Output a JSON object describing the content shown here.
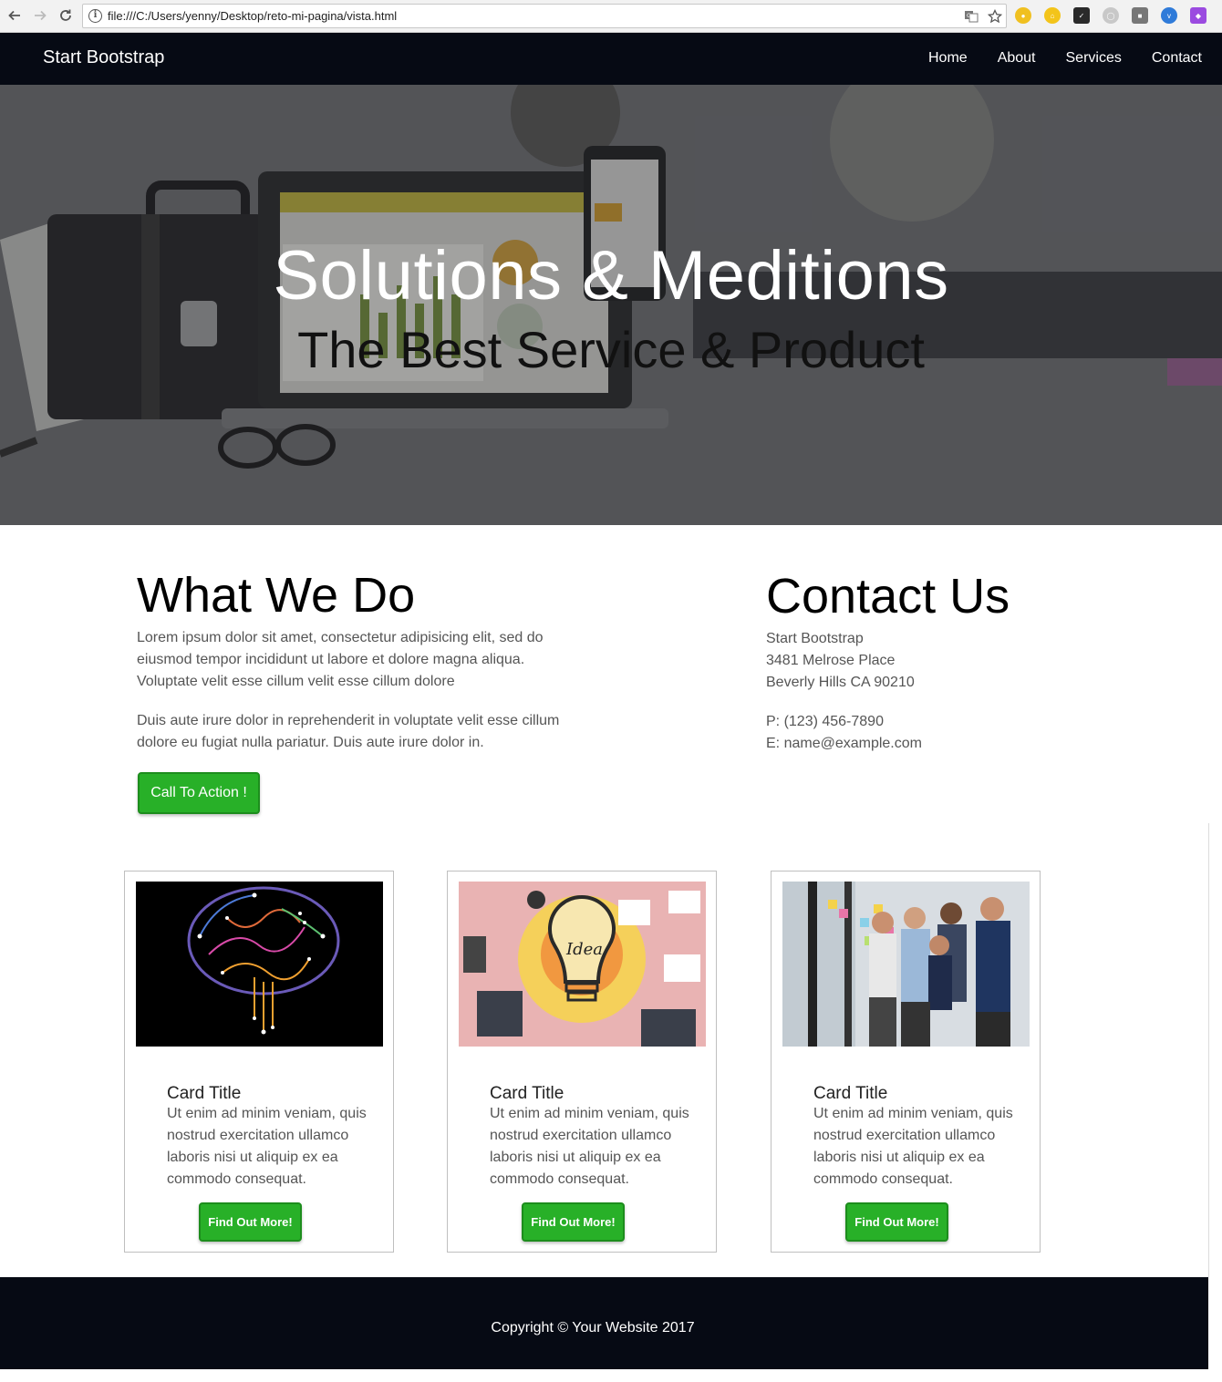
{
  "browser": {
    "url": "file:///C:/Users/yenny/Desktop/reto-mi-pagina/vista.html"
  },
  "navbar": {
    "brand": "Start Bootstrap",
    "links": [
      "Home",
      "About",
      "Services",
      "Contact"
    ]
  },
  "hero": {
    "title": "Solutions & Meditions",
    "subtitle": "The Best Service & Product"
  },
  "what_we_do": {
    "heading": "What We Do",
    "para1_lines": [
      "Lorem ipsum dolor sit amet, consectetur adipisicing elit, sed do",
      "eiusmod tempor incididunt ut labore et dolore magna aliqua.",
      "Voluptate velit esse cillum velit esse cillum dolore"
    ],
    "para2_lines": [
      "Duis aute irure dolor in reprehenderit in voluptate velit esse cillum",
      "dolore eu fugiat nulla pariatur. Duis aute irure dolor in."
    ],
    "cta_label": "Call To Action !"
  },
  "contact": {
    "heading": "Contact Us",
    "address_lines": [
      "Start Bootstrap",
      "3481 Melrose Place",
      "Beverly Hills CA 90210"
    ],
    "phone": "P: (123) 456-7890",
    "email": "E: name@example.com"
  },
  "cards": [
    {
      "title": "Card Title",
      "text_lines": [
        "Ut enim ad minim veniam, quis",
        "nostrud exercitation ullamco",
        "laboris nisi ut aliquip ex ea",
        "commodo consequat."
      ],
      "button": "Find Out More!"
    },
    {
      "title": "Card Title",
      "text_lines": [
        "Ut enim ad minim veniam, quis",
        "nostrud exercitation ullamco",
        "laboris nisi ut aliquip ex ea",
        "commodo consequat."
      ],
      "button": "Find Out More!"
    },
    {
      "title": "Card Title",
      "text_lines": [
        "Ut enim ad minim veniam, quis",
        "nostrud exercitation ullamco",
        "laboris nisi ut aliquip ex ea",
        "commodo consequat."
      ],
      "button": "Find Out More!"
    }
  ],
  "idea_text": "Idea",
  "footer": {
    "copyright": "Copyright © Your Website 2017"
  },
  "colors": {
    "nav_bg": "#060a14",
    "button_green": "#28b028"
  }
}
